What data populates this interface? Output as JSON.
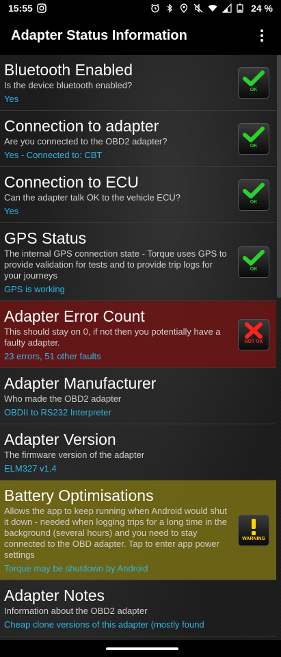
{
  "status_bar": {
    "time": "15:55",
    "battery": "24 %"
  },
  "app_bar": {
    "title": "Adapter Status Information"
  },
  "items": [
    {
      "title": "Bluetooth Enabled",
      "desc": "Is the device bluetooth enabled?",
      "value": "Yes",
      "status": "OK"
    },
    {
      "title": "Connection to adapter",
      "desc": "Are you connected to the OBD2 adapter?",
      "value": "Yes - Connected to: CBT",
      "status": "OK"
    },
    {
      "title": "Connection to ECU",
      "desc": "Can the adapter talk OK to the vehicle ECU?",
      "value": "Yes",
      "status": "OK"
    },
    {
      "title": "GPS Status",
      "desc": "The internal GPS connection state - Torque uses GPS to provide validation for tests and to provide trip logs for your journeys",
      "value": "GPS is working",
      "status": "OK"
    },
    {
      "title": "Adapter Error Count",
      "desc": "This should stay on 0, if not then you potentially have a faulty adapter.",
      "value": "23 errors, 51 other faults",
      "status": "NOT OK"
    },
    {
      "title": "Adapter Manufacturer",
      "desc": "Who made the OBD2 adapter",
      "value": "OBDII to RS232 Interpreter"
    },
    {
      "title": "Adapter Version",
      "desc": "The firmware version of the adapter",
      "value": "ELM327 v1.4"
    },
    {
      "title": "Battery Optimisations",
      "desc": "Allows the app to keep running when Android would shut it down - needed when logging trips for a long time in the background (several hours) and you need to stay connected to the OBD adapter. Tap to enter app power settings",
      "value": "Torque may be shutdown by Android",
      "status": "WARNING"
    },
    {
      "title": "Adapter Notes",
      "desc": "Information about the OBD2 adapter",
      "value": "Cheap clone versions of this adapter (mostly found"
    }
  ],
  "colors": {
    "value_text": "#33b5e5",
    "ok": "#2bd12b",
    "not_ok": "#ff2020",
    "warning": "#ffd400",
    "error_row": "#6e1414",
    "warning_row": "#786e14"
  },
  "icons": [
    "alarm-icon",
    "bluetooth-icon",
    "location-icon",
    "mute-icon",
    "wifi-icon",
    "signal-icon",
    "battery-icon",
    "instagram-icon",
    "overflow-menu-icon",
    "check-icon",
    "cross-icon",
    "exclamation-icon"
  ]
}
